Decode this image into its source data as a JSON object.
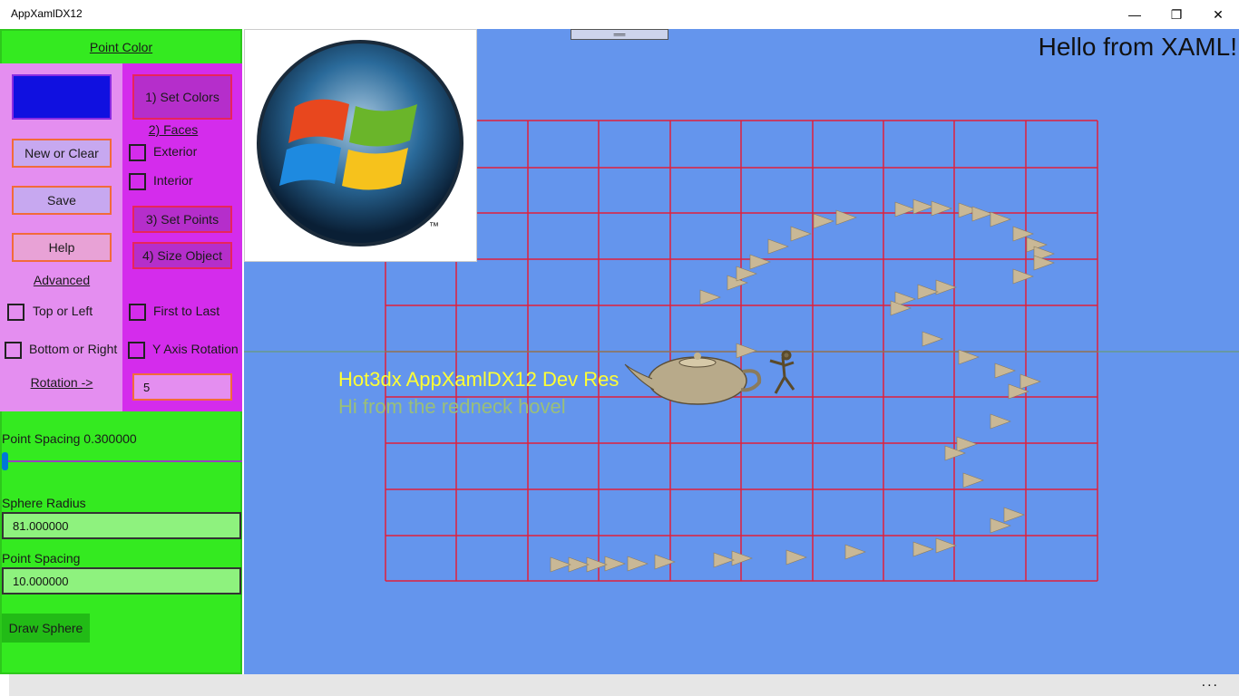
{
  "window": {
    "title": "AppXamlDX12",
    "minimize": "—",
    "maximize": "❐",
    "close": "✕"
  },
  "left": {
    "point_color": "Point Color",
    "swatch_color": "#1010e0",
    "new_clear": "New or Clear",
    "save": "Save",
    "help": "Help",
    "advanced": "Advanced",
    "set_colors": "1) Set Colors",
    "faces": "2) Faces",
    "exterior": "Exterior",
    "interior": "Interior",
    "set_points": "3) Set Points",
    "size_object": "4) Size Object",
    "top_left": "Top or Left",
    "first_last": "First to Last",
    "bottom_right": "Bottom or Right",
    "y_axis": "Y Axis Rotation",
    "rotation": "Rotation ->",
    "rotation_value": "5",
    "point_spacing_slider": "Point Spacing 0.300000",
    "sphere_radius_label": "Sphere Radius",
    "sphere_radius_value": "81.000000",
    "point_spacing_label": "Point Spacing",
    "point_spacing_value": "10.000000",
    "draw_sphere": "Draw Sphere"
  },
  "canvas": {
    "hello": "Hello from XAML!",
    "dev": "Hot3dx AppXamlDX12 Dev Res",
    "hi": "Hi from the redneck hovel",
    "logo_tm": "™",
    "background": "#6495ed"
  },
  "footer": {
    "more": "..."
  }
}
